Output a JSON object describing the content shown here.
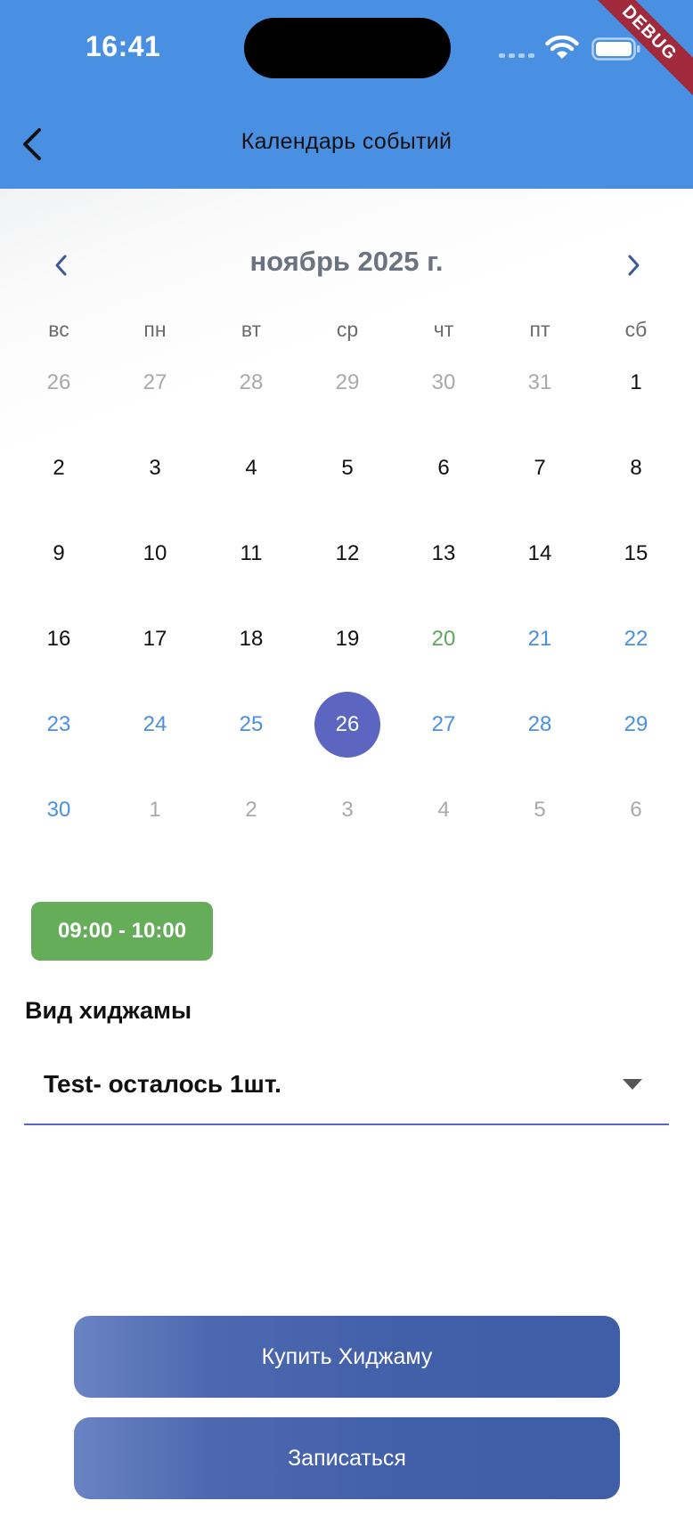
{
  "status_bar": {
    "time": "16:41"
  },
  "debug_label": "DEBUG",
  "app_bar": {
    "title": "Календарь событий",
    "back_icon": "chevron-left-icon"
  },
  "calendar": {
    "month_label": "ноябрь 2025 г.",
    "weekdays": [
      "вс",
      "пн",
      "вт",
      "ср",
      "чт",
      "пт",
      "сб"
    ],
    "days": [
      {
        "label": "26",
        "kind": "muted"
      },
      {
        "label": "27",
        "kind": "muted"
      },
      {
        "label": "28",
        "kind": "muted"
      },
      {
        "label": "29",
        "kind": "muted"
      },
      {
        "label": "30",
        "kind": "muted"
      },
      {
        "label": "31",
        "kind": "muted"
      },
      {
        "label": "1",
        "kind": "normal"
      },
      {
        "label": "2",
        "kind": "normal"
      },
      {
        "label": "3",
        "kind": "normal"
      },
      {
        "label": "4",
        "kind": "normal"
      },
      {
        "label": "5",
        "kind": "normal"
      },
      {
        "label": "6",
        "kind": "normal"
      },
      {
        "label": "7",
        "kind": "normal"
      },
      {
        "label": "8",
        "kind": "normal"
      },
      {
        "label": "9",
        "kind": "normal"
      },
      {
        "label": "10",
        "kind": "normal"
      },
      {
        "label": "11",
        "kind": "normal"
      },
      {
        "label": "12",
        "kind": "normal"
      },
      {
        "label": "13",
        "kind": "normal"
      },
      {
        "label": "14",
        "kind": "normal"
      },
      {
        "label": "15",
        "kind": "normal"
      },
      {
        "label": "16",
        "kind": "normal"
      },
      {
        "label": "17",
        "kind": "normal"
      },
      {
        "label": "18",
        "kind": "normal"
      },
      {
        "label": "19",
        "kind": "normal"
      },
      {
        "label": "20",
        "kind": "green"
      },
      {
        "label": "21",
        "kind": "blue"
      },
      {
        "label": "22",
        "kind": "blue"
      },
      {
        "label": "23",
        "kind": "blue"
      },
      {
        "label": "24",
        "kind": "blue"
      },
      {
        "label": "25",
        "kind": "blue"
      },
      {
        "label": "26",
        "kind": "selected"
      },
      {
        "label": "27",
        "kind": "blue"
      },
      {
        "label": "28",
        "kind": "blue"
      },
      {
        "label": "29",
        "kind": "blue"
      },
      {
        "label": "30",
        "kind": "blue"
      },
      {
        "label": "1",
        "kind": "muted"
      },
      {
        "label": "2",
        "kind": "muted"
      },
      {
        "label": "3",
        "kind": "muted"
      },
      {
        "label": "4",
        "kind": "muted"
      },
      {
        "label": "5",
        "kind": "muted"
      },
      {
        "label": "6",
        "kind": "muted"
      }
    ]
  },
  "time_slot": "09:00 - 10:00",
  "hijama_type": {
    "label": "Вид хиджамы",
    "selected_value": "Test- осталось 1шт."
  },
  "buttons": {
    "buy": "Купить Хиджаму",
    "signup": "Записаться"
  },
  "colors": {
    "app_bar": "#4a90e2",
    "selected_day": "#5c66c0",
    "available_day": "#4a90e2",
    "today": "#5aa85a",
    "time_slot": "#66ad5a"
  }
}
